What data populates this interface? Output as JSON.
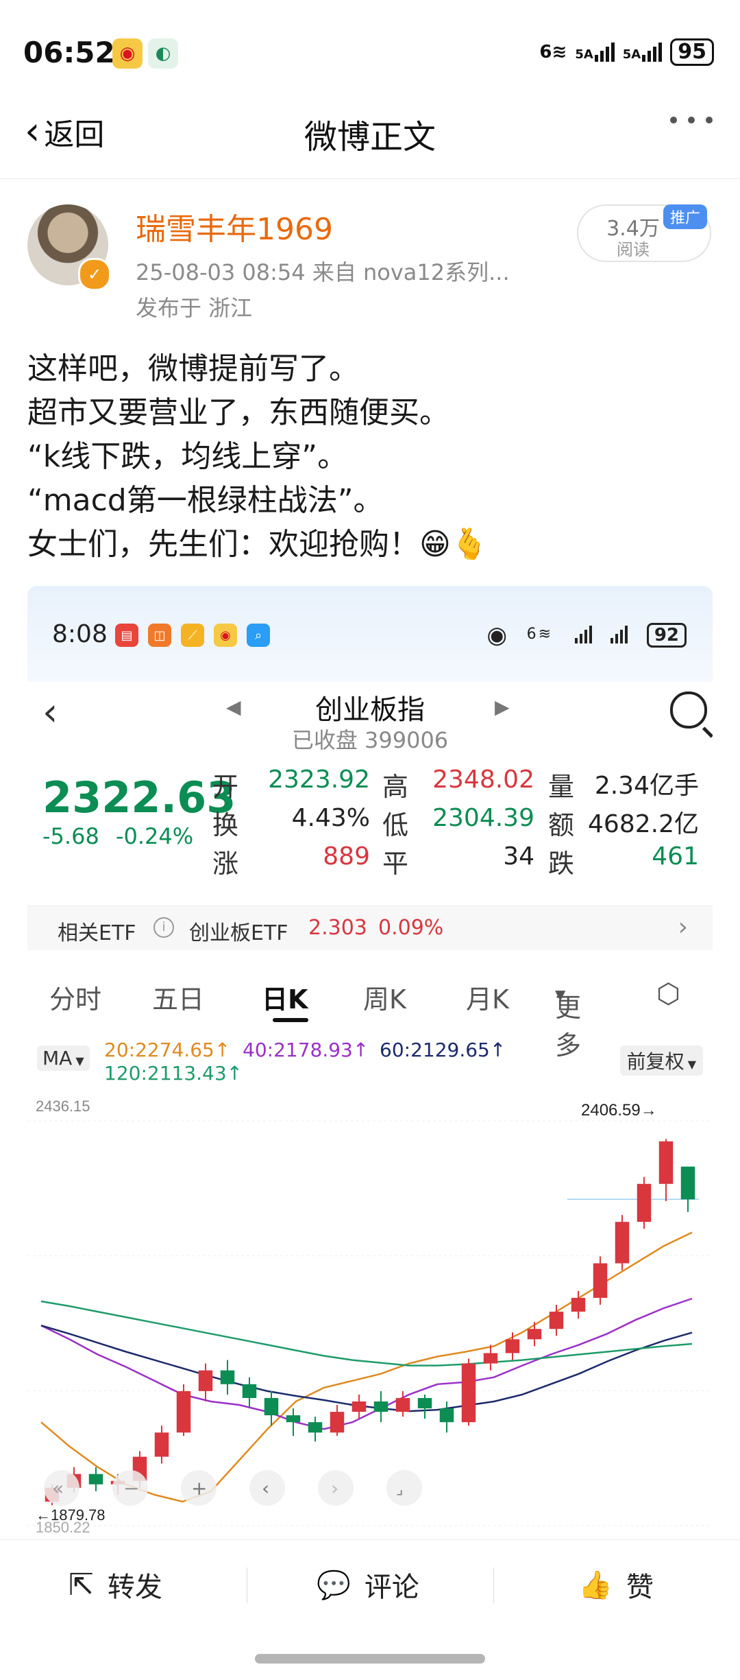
{
  "status_bar": {
    "time": "06:52",
    "battery": "95",
    "wifi": "6",
    "sig1": "5A",
    "sig2": "5A"
  },
  "nav": {
    "back_label": "返回",
    "title": "微博正文"
  },
  "post": {
    "author": "瑞雪丰年1969",
    "meta": "25-08-03 08:54  来自 nova12系列...",
    "location": "发布于 浙江",
    "read_count": "3.4万",
    "read_label": "阅读",
    "promo_tag": "推广",
    "lines": [
      "这样吧，微博提前写了。",
      "超市又要营业了，东西随便买。",
      "“k线下跌，均线上穿”。",
      "“macd第一根绿柱战法”。",
      "女士们，先生们：欢迎抢购！😁🫰"
    ]
  },
  "embed": {
    "time": "8:08",
    "battery": "92",
    "wifi": "6",
    "index_name": "创业板指",
    "index_code": "已收盘 399006",
    "price": "2322.63",
    "change": "-5.68  -0.24%",
    "quotes": {
      "open_label": "开",
      "open": "2323.92",
      "high_label": "高",
      "high": "2348.02",
      "vol_label": "量",
      "vol": "2.34亿手",
      "turn_label": "换",
      "turn": "4.43%",
      "low_label": "低",
      "low": "2304.39",
      "amt_label": "额",
      "amt": "4682.2亿",
      "up_label": "涨",
      "up": "889",
      "flat_label": "平",
      "flat": "34",
      "down_label": "跌",
      "down": "461"
    },
    "etf": {
      "label": "相关ETF",
      "name": "创业板ETF",
      "price": "2.303",
      "pct": "0.09%"
    },
    "tabs": [
      "分时",
      "五日",
      "日K",
      "周K",
      "月K",
      "更多"
    ],
    "active_tab": "日K",
    "ma": {
      "label": "MA",
      "ma20": "20:2274.65↑",
      "ma40": "40:2178.93↑",
      "ma60": "60:2129.65↑",
      "ma120": "120:2113.43↑",
      "adjust": "前复权"
    },
    "axis": {
      "top": "2436.15",
      "high_marker": "2406.59→",
      "low_marker": "←1879.78",
      "bottom": "1850.22"
    },
    "colors": {
      "up": "#d9363e",
      "down": "#0b8d53",
      "ma20": "#e08a1e",
      "ma40": "#9b2fc9",
      "ma60": "#1b2a6b",
      "ma120": "#1e9b6a"
    }
  },
  "chart_data": {
    "type": "candlestick",
    "ylim": [
      1850.22,
      2436.15
    ],
    "high_label": "2406.59",
    "low_label": "1879.78",
    "series": [
      {
        "name": "20",
        "values": [
          2000,
          1965,
          1935,
          1910,
          1895,
          1885,
          1900,
          1945,
          1990,
          2030,
          2050,
          2060,
          2070,
          2085,
          2095,
          2102,
          2110,
          2130,
          2155,
          2180,
          2205,
          2230,
          2255,
          2274.65
        ]
      },
      {
        "name": "40",
        "values": [
          2140,
          2120,
          2098,
          2080,
          2060,
          2040,
          2030,
          2025,
          2015,
          2000,
          1990,
          2000,
          2020,
          2040,
          2055,
          2058,
          2065,
          2082,
          2098,
          2112,
          2128,
          2148,
          2165,
          2178.93
        ]
      },
      {
        "name": "60",
        "values": [
          2140,
          2128,
          2115,
          2102,
          2090,
          2078,
          2066,
          2055,
          2045,
          2038,
          2032,
          2025,
          2020,
          2016,
          2018,
          2024,
          2030,
          2040,
          2055,
          2070,
          2088,
          2104,
          2118,
          2129.65
        ]
      },
      {
        "name": "120",
        "values": [
          2175,
          2168,
          2160,
          2152,
          2144,
          2136,
          2128,
          2120,
          2112,
          2104,
          2096,
          2090,
          2086,
          2082,
          2082,
          2084,
          2087,
          2090,
          2094,
          2098,
          2102,
          2106,
          2110,
          2113.43
        ]
      }
    ],
    "candles": [
      [
        1885,
        1905,
        1879.78,
        1910
      ],
      [
        1905,
        1925,
        1898,
        1935
      ],
      [
        1925,
        1910,
        1900,
        1935
      ],
      [
        1910,
        1915,
        1895,
        1925
      ],
      [
        1915,
        1950,
        1905,
        1958
      ],
      [
        1950,
        1985,
        1940,
        1995
      ],
      [
        1985,
        2045,
        1980,
        2055
      ],
      [
        2045,
        2075,
        2030,
        2085
      ],
      [
        2075,
        2055,
        2040,
        2090
      ],
      [
        2055,
        2035,
        2020,
        2065
      ],
      [
        2035,
        2010,
        1995,
        2045
      ],
      [
        2010,
        2000,
        1980,
        2020
      ],
      [
        2000,
        1985,
        1972,
        2008
      ],
      [
        1985,
        2015,
        1980,
        2025
      ],
      [
        2015,
        2030,
        2005,
        2040
      ],
      [
        2030,
        2015,
        2000,
        2045
      ],
      [
        2015,
        2035,
        2008,
        2045
      ],
      [
        2035,
        2020,
        2005,
        2040
      ],
      [
        2020,
        2000,
        1985,
        2030
      ],
      [
        2000,
        2085,
        1995,
        2092
      ],
      [
        2085,
        2100,
        2075,
        2112
      ],
      [
        2100,
        2120,
        2090,
        2130
      ],
      [
        2120,
        2135,
        2110,
        2145
      ],
      [
        2135,
        2160,
        2125,
        2170
      ],
      [
        2160,
        2180,
        2150,
        2190
      ],
      [
        2180,
        2230,
        2170,
        2240
      ],
      [
        2230,
        2290,
        2220,
        2300
      ],
      [
        2290,
        2345,
        2280,
        2355
      ],
      [
        2345,
        2406.59,
        2320,
        2410
      ],
      [
        2370,
        2322.63,
        2304.39,
        2348.02
      ]
    ]
  },
  "bottom_bar": {
    "repost": "转发",
    "comment": "评论",
    "like": "赞"
  }
}
